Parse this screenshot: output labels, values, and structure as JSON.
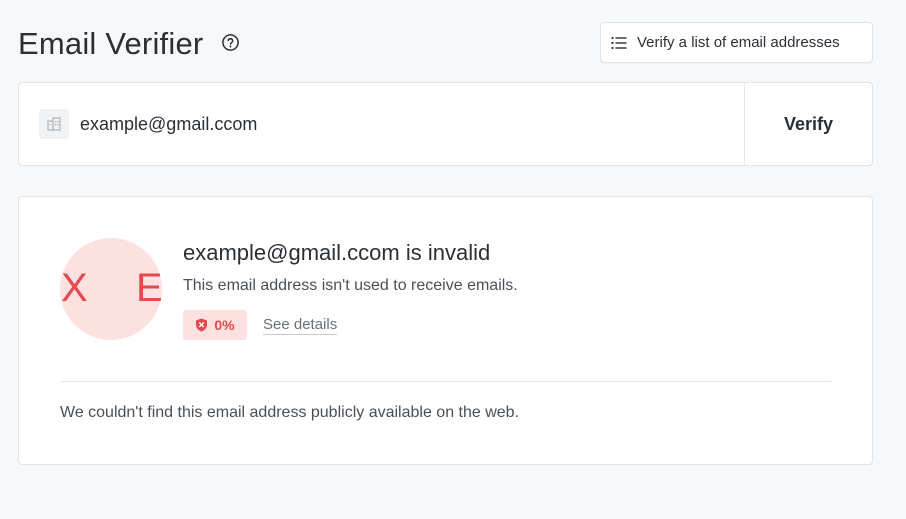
{
  "header": {
    "title": "Email Verifier",
    "help_icon": "question-circle-icon",
    "bulk_button_label": "Verify a list of email addresses",
    "bulk_button_icon": "list-icon"
  },
  "search": {
    "value": "example@gmail.ccom",
    "icon": "company-icon",
    "verify_label": "Verify"
  },
  "result": {
    "avatar_letters": [
      "X",
      "E"
    ],
    "title": "example@gmail.ccom is invalid",
    "description": "This email address isn't used to receive emails.",
    "score_icon": "shield-x-icon",
    "score": "0%",
    "details_label": "See details",
    "web_note": "We couldn't find this email address publicly available on the web."
  },
  "colors": {
    "invalid_red": "#e5484d",
    "invalid_bg": "#fde0e0",
    "page_bg": "#f7f8fa"
  }
}
